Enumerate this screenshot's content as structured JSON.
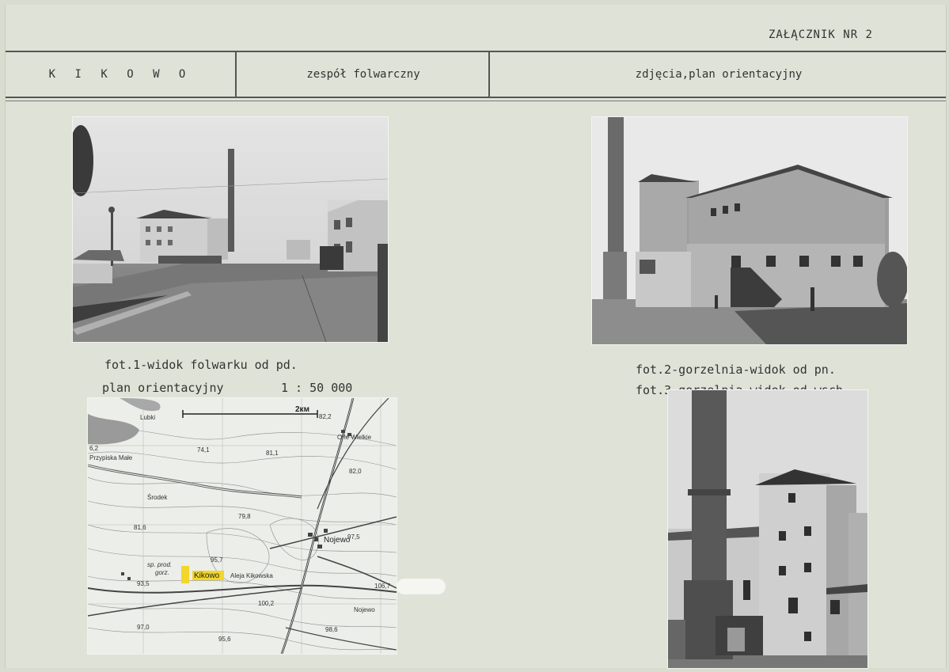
{
  "header": {
    "annex": "ZAŁĄCZNIK  NR 2",
    "place": "K I K O W O",
    "complex": "zespół folwarczny",
    "content": "zdjęcia,plan orientacyjny"
  },
  "captions": {
    "photo1": "fot.1-widok folwarku od pd.",
    "plan": "plan orientacyjny",
    "scale": "1 : 50 000",
    "photo2": "fot.2-gorzelnia-widok od pn.",
    "photo3": "fot.3-gorzelnia-widok od wsch."
  },
  "map": {
    "scalebar": "2км",
    "labels": {
      "top_left": "Lubki",
      "village1": "Orle Wielkie",
      "village2": "Przypiska Małe",
      "village3": "Środek",
      "village4": "Nojewo",
      "village5": "Aleja Kikowska",
      "village6": "Nojewo",
      "farm_note1": "sp. prod.",
      "farm_note2": "gorz.",
      "highlight": "Kikowo",
      "n1": "82,2",
      "n2": "82,0",
      "n3": "81,1",
      "n4": "79,8",
      "n5": "97,5",
      "n6": "95,7",
      "n7": "93,5",
      "n8": "106,7",
      "n9": "100,2",
      "n10": "97,0",
      "n11": "98,6",
      "n12": "95,6",
      "n13": "6,2",
      "n14": "74,1",
      "n15": "81,6"
    }
  }
}
